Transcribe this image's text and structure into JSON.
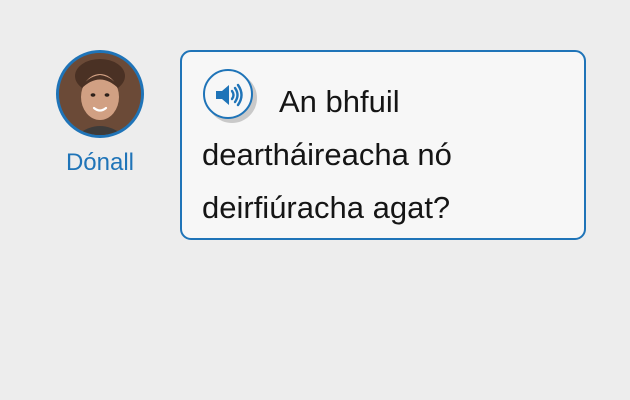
{
  "speaker": {
    "name": "Dónall",
    "avatar_icon": "person-avatar"
  },
  "message": {
    "audio_icon": "speaker-icon",
    "text": "An bhfuil deartháireacha nó deirfiúracha agat?"
  },
  "colors": {
    "accent": "#1f74b8",
    "background": "#ededed",
    "bubble": "#f7f7f7",
    "text": "#151515"
  }
}
